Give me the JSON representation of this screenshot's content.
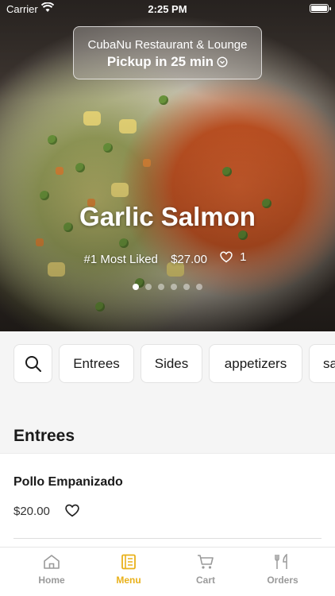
{
  "status_bar": {
    "carrier": "Carrier",
    "time": "2:25 PM"
  },
  "pickup": {
    "restaurant": "CubaNu Restaurant & Lounge",
    "eta": "Pickup in 25 min"
  },
  "featured": {
    "title": "Garlic Salmon",
    "rank": "#1 Most Liked",
    "price": "$27.00",
    "likes": "1",
    "slides": 6,
    "active_slide": 1
  },
  "categories": [
    {
      "label": "search",
      "icon": "search-icon"
    },
    {
      "label": "Entrees"
    },
    {
      "label": "Sides"
    },
    {
      "label": "appetizers"
    },
    {
      "label": "sa"
    }
  ],
  "section": {
    "title": "Entrees"
  },
  "items": [
    {
      "name": "Pollo Empanizado",
      "price": "$20.00"
    }
  ],
  "tabs": [
    {
      "label": "Home",
      "icon": "home-icon",
      "active": false
    },
    {
      "label": "Menu",
      "icon": "menu-icon",
      "active": true
    },
    {
      "label": "Cart",
      "icon": "cart-icon",
      "active": false
    },
    {
      "label": "Orders",
      "icon": "orders-icon",
      "active": false
    }
  ],
  "colors": {
    "accent": "#e9b11a",
    "tab_inactive": "#9a9a9a",
    "background": "#f5f5f5"
  }
}
